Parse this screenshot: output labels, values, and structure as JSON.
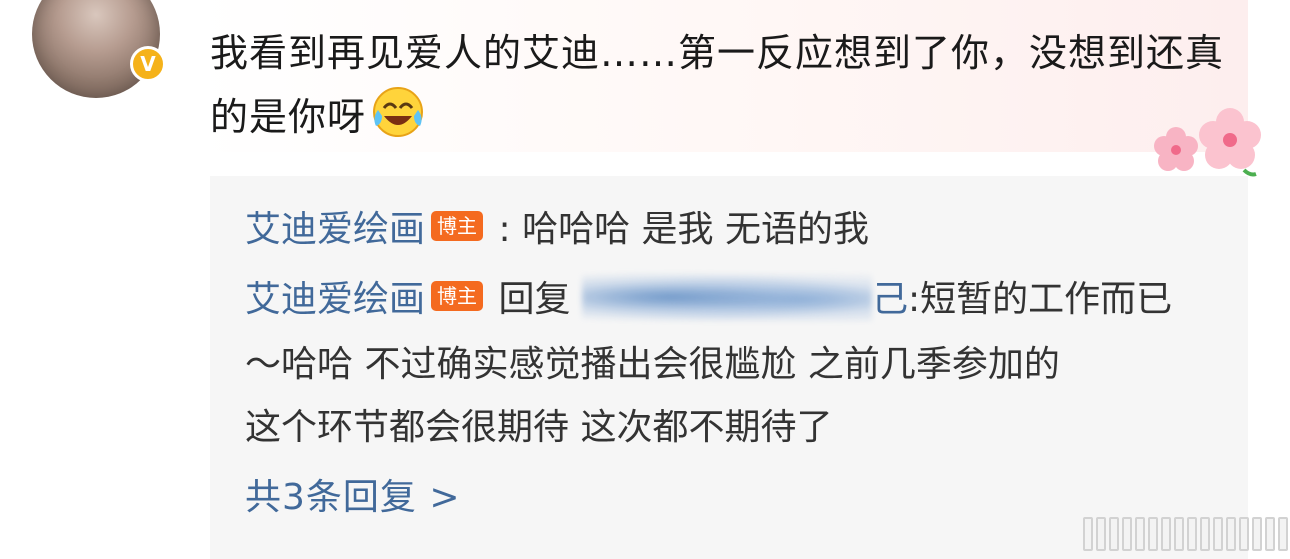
{
  "comment": {
    "text": "我看到再见爱人的艾迪……第一反应想到了你，没想到还真的是你呀",
    "emoji": "laughing-crying-face"
  },
  "replies": [
    {
      "user": "艾迪爱绘画",
      "badge": "博主",
      "separator": ":",
      "text": "哈哈哈 是我 无语的我"
    },
    {
      "user": "艾迪爱绘画",
      "badge": "博主",
      "reply_prefix": "回复",
      "mention_tail": "己",
      "line1_text": ":短暂的工作而已",
      "line2_text": "～哈哈 不过确实感觉播出会很尴尬  之前几季参加的",
      "line3_text": "这个环节都会很期待  这次都不期待了"
    }
  ],
  "more_replies": "共3条回复 >",
  "colors": {
    "username": "#41699a",
    "badge_bg": "#f46a1f",
    "reply_bg": "#f6f6f6",
    "verified": "#f5b21a"
  }
}
